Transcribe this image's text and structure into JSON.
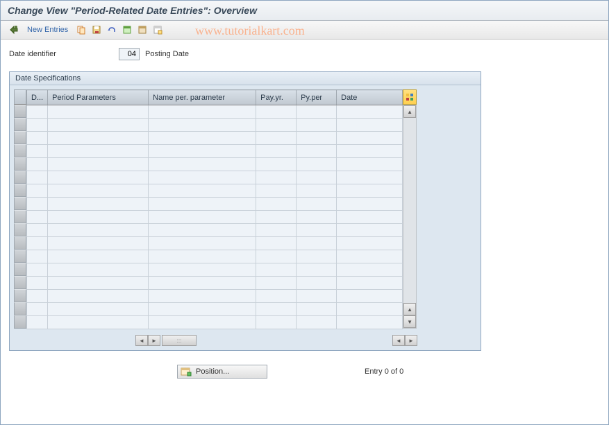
{
  "title": "Change View \"Period-Related Date Entries\": Overview",
  "toolbar": {
    "new_entries_label": "New Entries"
  },
  "watermark": "www.tutorialkart.com",
  "identifier": {
    "label": "Date identifier",
    "value": "04",
    "description": "Posting Date"
  },
  "panel": {
    "title": "Date Specifications"
  },
  "columns": {
    "d": "D...",
    "period_params": "Period Parameters",
    "name_param": "Name per. parameter",
    "pay_yr": "Pay.yr.",
    "py_per": "Py.per",
    "date": "Date"
  },
  "rows": [
    {
      "d": "",
      "period": "",
      "name": "",
      "payyr": "",
      "pyper": "",
      "date": ""
    },
    {
      "d": "",
      "period": "",
      "name": "",
      "payyr": "",
      "pyper": "",
      "date": ""
    },
    {
      "d": "",
      "period": "",
      "name": "",
      "payyr": "",
      "pyper": "",
      "date": ""
    },
    {
      "d": "",
      "period": "",
      "name": "",
      "payyr": "",
      "pyper": "",
      "date": ""
    },
    {
      "d": "",
      "period": "",
      "name": "",
      "payyr": "",
      "pyper": "",
      "date": ""
    },
    {
      "d": "",
      "period": "",
      "name": "",
      "payyr": "",
      "pyper": "",
      "date": ""
    },
    {
      "d": "",
      "period": "",
      "name": "",
      "payyr": "",
      "pyper": "",
      "date": ""
    },
    {
      "d": "",
      "period": "",
      "name": "",
      "payyr": "",
      "pyper": "",
      "date": ""
    },
    {
      "d": "",
      "period": "",
      "name": "",
      "payyr": "",
      "pyper": "",
      "date": ""
    },
    {
      "d": "",
      "period": "",
      "name": "",
      "payyr": "",
      "pyper": "",
      "date": ""
    },
    {
      "d": "",
      "period": "",
      "name": "",
      "payyr": "",
      "pyper": "",
      "date": ""
    },
    {
      "d": "",
      "period": "",
      "name": "",
      "payyr": "",
      "pyper": "",
      "date": ""
    },
    {
      "d": "",
      "period": "",
      "name": "",
      "payyr": "",
      "pyper": "",
      "date": ""
    },
    {
      "d": "",
      "period": "",
      "name": "",
      "payyr": "",
      "pyper": "",
      "date": ""
    },
    {
      "d": "",
      "period": "",
      "name": "",
      "payyr": "",
      "pyper": "",
      "date": ""
    },
    {
      "d": "",
      "period": "",
      "name": "",
      "payyr": "",
      "pyper": "",
      "date": ""
    },
    {
      "d": "",
      "period": "",
      "name": "",
      "payyr": "",
      "pyper": "",
      "date": ""
    }
  ],
  "footer": {
    "position_label": "Position...",
    "entry_status": "Entry 0 of 0"
  }
}
